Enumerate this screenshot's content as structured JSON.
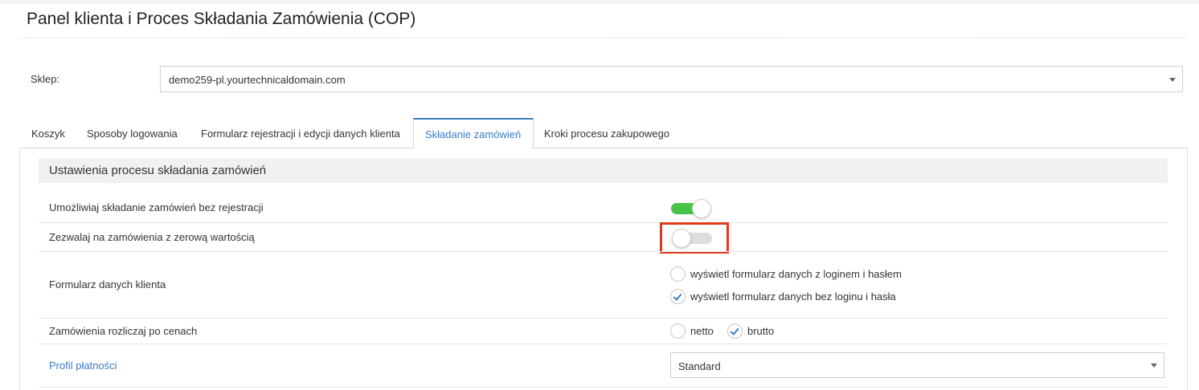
{
  "page": {
    "title": "Panel klienta i Proces Składania Zamówienia (COP)"
  },
  "shop": {
    "label": "Sklep:",
    "value": "demo259-pl.yourtechnicaldomain.com"
  },
  "tabs": [
    {
      "label": "Koszyk",
      "active": false
    },
    {
      "label": "Sposoby logowania",
      "active": false
    },
    {
      "label": "Formularz rejestracji i edycji danych klienta",
      "active": false
    },
    {
      "label": "Składanie zamówień",
      "active": true
    },
    {
      "label": "Kroki procesu zakupowego",
      "active": false
    }
  ],
  "section": {
    "title": "Ustawienia procesu składania zamówień"
  },
  "settings": {
    "guest_checkout": {
      "label": "Umożliwiaj składanie zamówień bez rejestracji",
      "enabled": true
    },
    "zero_value": {
      "label": "Zezwalaj na zamówienia z zerową wartością",
      "enabled": false
    },
    "customer_form": {
      "label": "Formularz danych klienta",
      "options": [
        {
          "label": "wyświetl formularz danych z loginem i hasłem",
          "selected": false
        },
        {
          "label": "wyświetl formularz danych bez loginu i hasła",
          "selected": true
        }
      ]
    },
    "pricing": {
      "label": "Zamówienia rozliczaj po cenach",
      "options": [
        {
          "label": "netto",
          "selected": false
        },
        {
          "label": "brutto",
          "selected": true
        }
      ]
    },
    "payment_profile": {
      "label": "Profil płatności",
      "value": "Standard"
    }
  },
  "colors": {
    "accent": "#3a7dc2",
    "toggle_on": "#47c34a",
    "highlight": "#e03a1e"
  }
}
